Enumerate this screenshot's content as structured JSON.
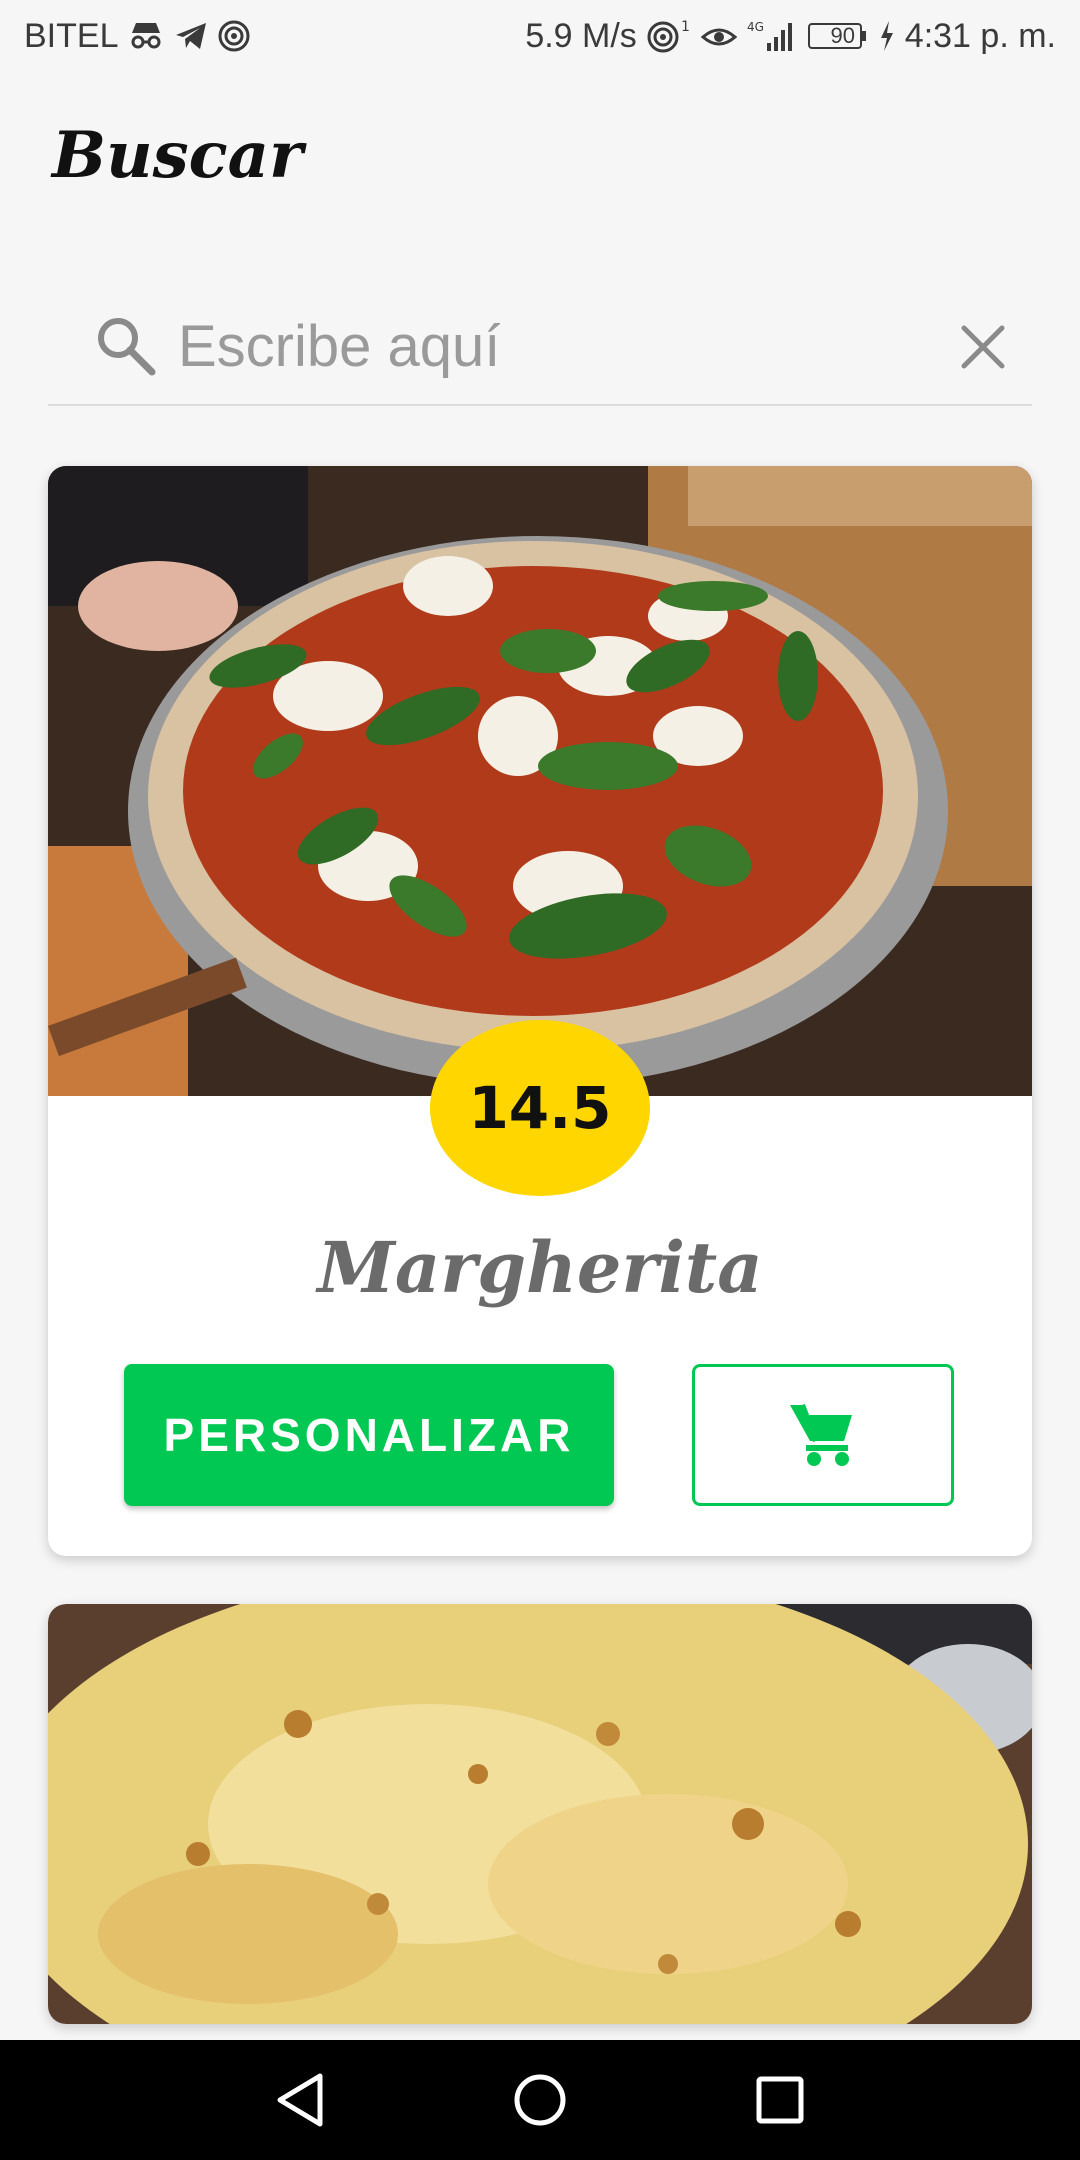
{
  "status_bar": {
    "carrier": "BITEL",
    "speed": "5.9 M/s",
    "battery": "90",
    "time": "4:31 p. m."
  },
  "header": {
    "title": "Buscar"
  },
  "search": {
    "placeholder": "Escribe aquí",
    "value": ""
  },
  "cards": [
    {
      "price": "14.5",
      "name": "Margherita",
      "personalize_label": "PERSONALIZAR",
      "cart_icon": "cart-icon"
    },
    {
      "image": "cheese-pizza-photo"
    }
  ],
  "colors": {
    "accent_green": "#00c853",
    "price_yellow": "#ffd600",
    "navbar": "#000000"
  }
}
